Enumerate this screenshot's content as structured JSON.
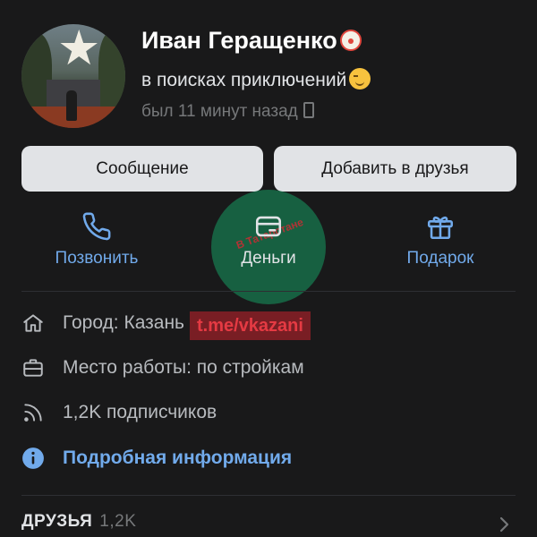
{
  "profile": {
    "name": "Иван Геращенко",
    "name_emoji": "clown-face-icon",
    "status": "в поисках приключений",
    "status_emoji": "winking-face-icon",
    "last_seen": "был 11 минут назад",
    "last_seen_icon": "mobile-phone-icon"
  },
  "buttons": {
    "message": "Сообщение",
    "add_friend": "Добавить в друзья"
  },
  "actions": [
    {
      "label": "Позвонить",
      "icon": "phone-icon"
    },
    {
      "label": "Деньги",
      "icon": "money-card-icon"
    },
    {
      "label": "Подарок",
      "icon": "gift-icon"
    }
  ],
  "info": {
    "city": "Город: Казань",
    "work": "Место работы: по стройкам",
    "followers": "1,2K подписчиков",
    "details_link": "Подробная информация"
  },
  "friends": {
    "label": "ДРУЗЬЯ",
    "count": "1,2K"
  },
  "watermark": {
    "logo_text": "В Татарстане",
    "link": "t.me/vkazani"
  },
  "colors": {
    "background": "#19191a",
    "accent": "#71aaeb",
    "button_bg": "#e1e3e6",
    "secondary_text": "#76787a"
  }
}
